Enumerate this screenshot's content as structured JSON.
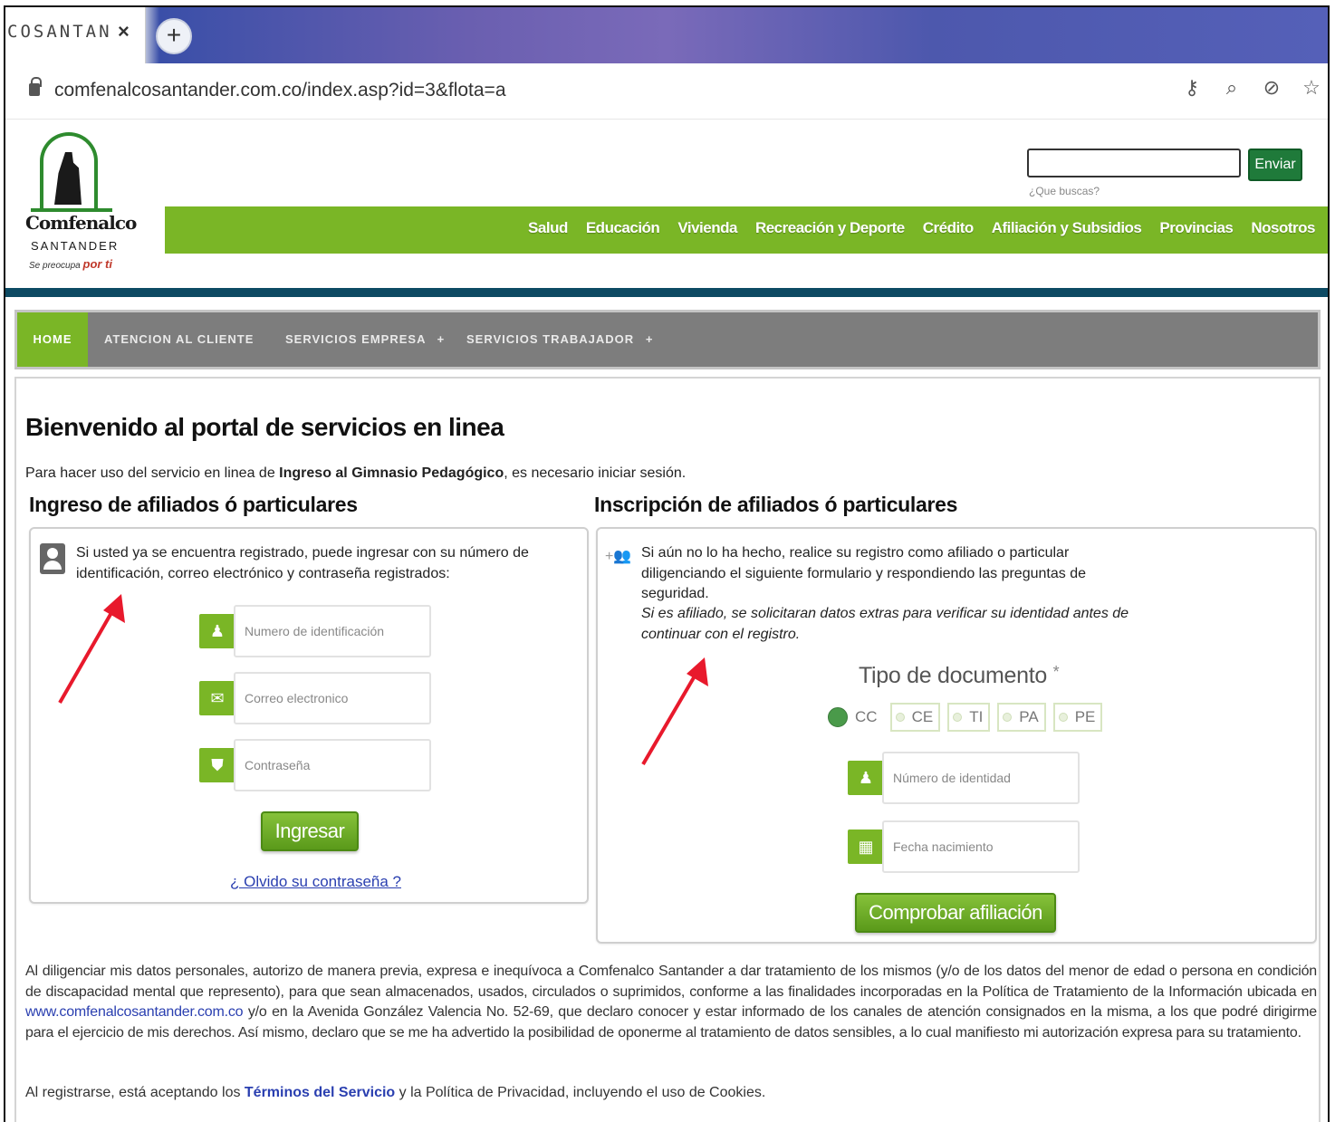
{
  "browser": {
    "tab_title": "COSANTAN",
    "tab_close": "×",
    "new_tab": "+",
    "url": "comfenalcosantander.com.co/index.asp?id=3&flota=a"
  },
  "site": {
    "logo": {
      "name": "Comfenalco",
      "sub": "SANTANDER",
      "tagline_prefix": "Se preocupa",
      "tagline_accent": "por ti"
    },
    "search": {
      "button": "Enviar",
      "hint": "¿Que buscas?"
    },
    "main_nav": [
      "Salud",
      "Educación",
      "Vivienda",
      "Recreación y Deporte",
      "Crédito",
      "Afiliación y Subsidios",
      "Provincias",
      "Nosotros"
    ],
    "sub_nav": {
      "home": "HOME",
      "atencion": "ATENCION AL CLIENTE",
      "empresa": "SERVICIOS EMPRESA",
      "trabajador": "SERVICIOS TRABAJADOR",
      "plus": "+"
    }
  },
  "page": {
    "title": "Bienvenido al portal de servicios en linea",
    "intro_pre": "Para hacer uso del servicio en linea de ",
    "intro_bold": "Ingreso al Gimnasio Pedagógico",
    "intro_post": ", es necesario iniciar sesión."
  },
  "login": {
    "title": "Ingreso de afiliados ó particulares",
    "description": "Si usted ya se encuentra registrado, puede ingresar con su número de identificación, correo electrónico y contraseña registrados:",
    "id_placeholder": "Numero de identificación",
    "email_placeholder": "Correo electronico",
    "password_placeholder": "Contraseña",
    "submit": "Ingresar",
    "forgot": "¿ Olvido su contraseña ?"
  },
  "register": {
    "title": "Inscripción de afiliados ó particulares",
    "description": "Si aún no lo ha hecho, realice su registro como afiliado o particular diligenciando el siguiente formulario y respondiendo las preguntas de seguridad.",
    "note": "Si es afiliado, se solicitaran datos extras para verificar su identidad antes de continuar con el registro.",
    "doc_label": "Tipo de documento",
    "required_mark": "*",
    "doc_types": [
      "CC",
      "CE",
      "TI",
      "PA",
      "PE"
    ],
    "selected_doc": "CC",
    "identity_placeholder": "Número de identidad",
    "birth_placeholder": "Fecha nacimiento",
    "submit": "Comprobar afiliación"
  },
  "legal": {
    "text_pre": "Al diligenciar mis datos personales, autorizo de manera previa, expresa e inequívoca a Comfenalco Santander a dar tratamiento de los mismos (y/o de los datos del menor de edad o persona en condición de discapacidad mental que represento), para que sean almacenados, usados, circulados o suprimidos, conforme a las finalidades incorporadas en la Política de Tratamiento de la Información ubicada en ",
    "link": "www.comfenalcosantander.com.co",
    "text_post": " y/o en la Avenida González Valencia No. 52-69, que declaro conocer y estar informado de los canales de atención consignados en la misma, a los que podré dirigirme para el ejercicio de mis derechos. Así mismo, declaro que se me ha advertido la posibilidad de oponerme al tratamiento de datos sensibles, a lo cual manifiesto mi autorización expresa para su tratamiento.",
    "terms_pre": "Al registrarse, está aceptando los ",
    "terms_link": "Términos del Servicio",
    "terms_post": " y la Política de Privacidad, incluyendo el uso de Cookies."
  },
  "colors": {
    "green": "#7ab626",
    "dark_blue": "#0d4a63",
    "grey_nav": "#7d7d7d",
    "link": "#2a3fb0",
    "annotation": "#e8192c"
  }
}
